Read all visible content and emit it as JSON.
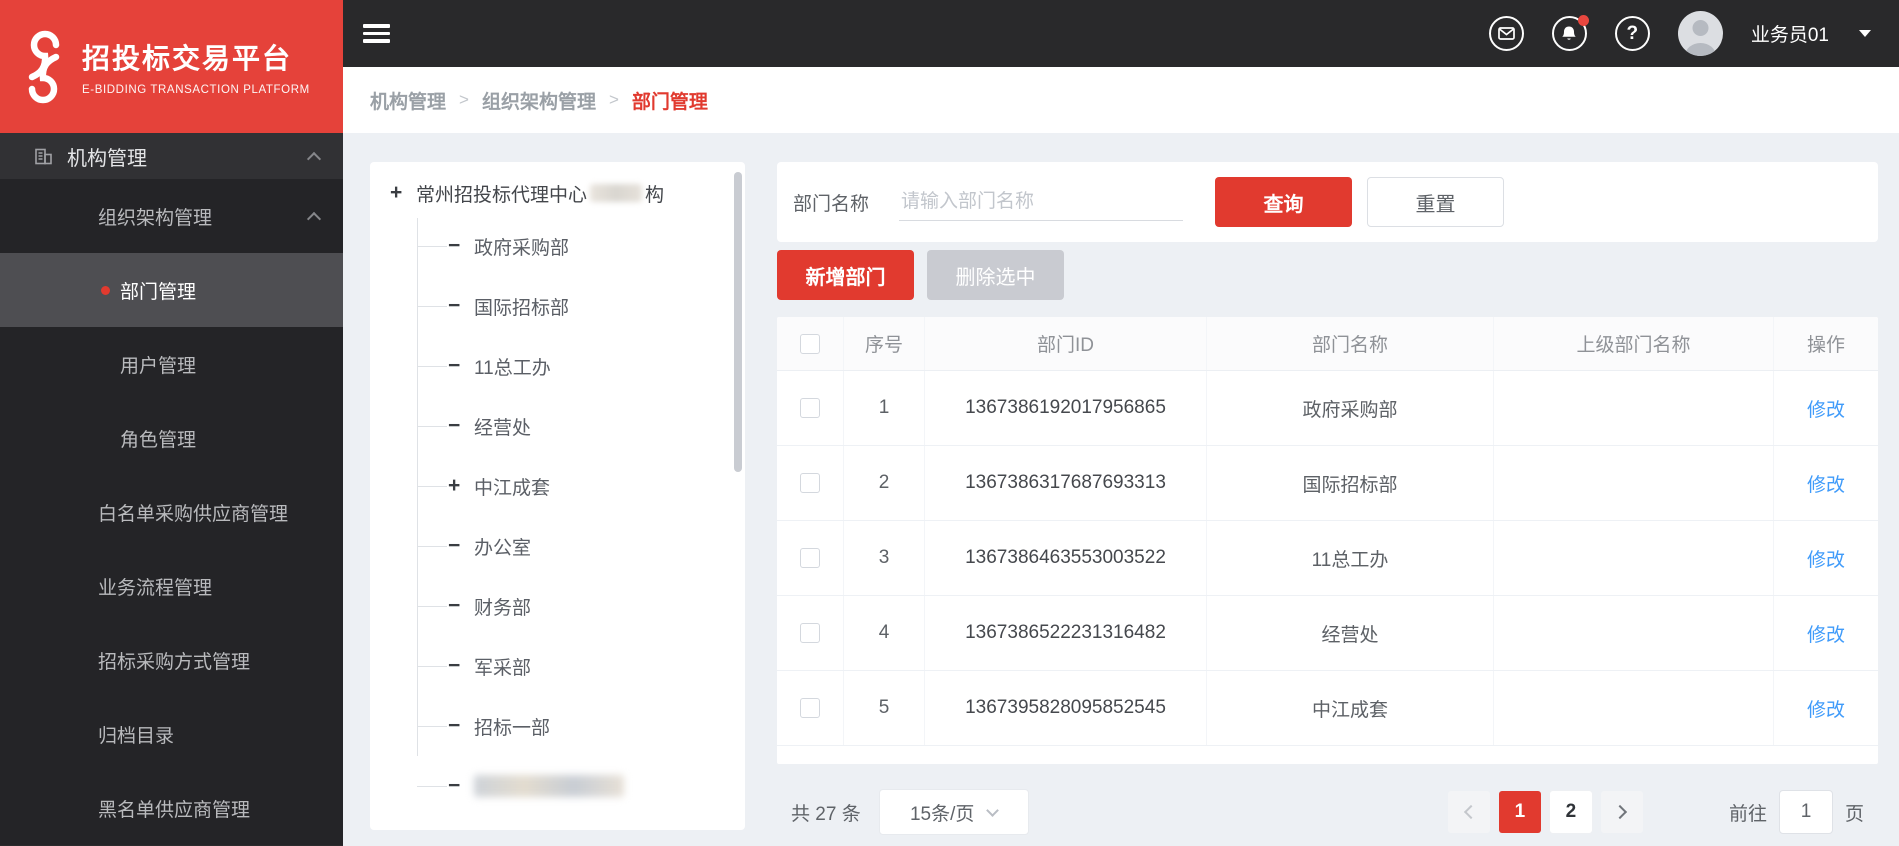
{
  "logo": {
    "title": "招投标交易平台",
    "subtitle": "E-BIDDING TRANSACTION PLATFORM"
  },
  "topbar": {
    "user_name": "业务员01",
    "icons": [
      "message-icon",
      "notification-bell-icon",
      "help-icon"
    ],
    "help_glyph": "?",
    "notification_has_badge": true
  },
  "breadcrumb": {
    "items": [
      "机构管理",
      "组织架构管理",
      "部门管理"
    ],
    "separator": ">"
  },
  "sidebar": {
    "items": [
      {
        "label": "机构管理",
        "level": 1,
        "icon": "building-icon",
        "expanded": true
      },
      {
        "label": "组织架构管理",
        "level": 2,
        "expanded": true
      },
      {
        "label": "部门管理",
        "level": 3,
        "active": true
      },
      {
        "label": "用户管理",
        "level": 3
      },
      {
        "label": "角色管理",
        "level": 3
      },
      {
        "label": "白名单采购供应商管理",
        "level": 2
      },
      {
        "label": "业务流程管理",
        "level": 2
      },
      {
        "label": "招标采购方式管理",
        "level": 2
      },
      {
        "label": "归档目录",
        "level": 2
      },
      {
        "label": "黑名单供应商管理",
        "level": 2
      }
    ]
  },
  "tree": {
    "root": {
      "toggle": "+",
      "prefix": "常州招投标代理中心",
      "suffix": "构",
      "redacted_middle": true
    },
    "children": [
      {
        "toggle": "−",
        "label": "政府采购部"
      },
      {
        "toggle": "−",
        "label": "国际招标部"
      },
      {
        "toggle": "−",
        "label": "11总工办"
      },
      {
        "toggle": "−",
        "label": "经营处"
      },
      {
        "toggle": "+",
        "label": "中江成套"
      },
      {
        "toggle": "−",
        "label": "办公室"
      },
      {
        "toggle": "−",
        "label": "财务部"
      },
      {
        "toggle": "−",
        "label": "军采部"
      },
      {
        "toggle": "−",
        "label": "招标一部"
      },
      {
        "toggle": "−",
        "label": "",
        "redacted": true
      }
    ]
  },
  "search": {
    "label": "部门名称",
    "placeholder": "请输入部门名称",
    "value": "",
    "query_label": "查询",
    "reset_label": "重置"
  },
  "actions": {
    "add_label": "新增部门",
    "delete_label": "删除选中",
    "delete_disabled": true
  },
  "table": {
    "columns": [
      "序号",
      "部门ID",
      "部门名称",
      "上级部门名称",
      "操作"
    ],
    "action_label": "修改",
    "rows": [
      {
        "index": "1",
        "dept_id": "1367386192017956865",
        "dept_name": "政府采购部",
        "parent_name": ""
      },
      {
        "index": "2",
        "dept_id": "1367386317687693313",
        "dept_name": "国际招标部",
        "parent_name": ""
      },
      {
        "index": "3",
        "dept_id": "1367386463553003522",
        "dept_name": "11总工办",
        "parent_name": ""
      },
      {
        "index": "4",
        "dept_id": "1367386522231316482",
        "dept_name": "经营处",
        "parent_name": ""
      },
      {
        "index": "5",
        "dept_id": "1367395828095852545",
        "dept_name": "中江成套",
        "parent_name": ""
      }
    ]
  },
  "pagination": {
    "total_text": "共 27 条",
    "page_size": "15条/页",
    "pages": [
      "1",
      "2"
    ],
    "current_page": "1",
    "goto_label": "前往",
    "goto_value": "1",
    "goto_suffix": "页"
  },
  "colors": {
    "accent_red": "#e13a2f",
    "logo_red": "#e5423a",
    "link_blue": "#3f9bfa",
    "sidebar_dark": "#2b2b2d",
    "sidebar_active": "#4e4e52",
    "content_bg": "#edf0f4",
    "disabled_gray": "#c9cbd1"
  }
}
